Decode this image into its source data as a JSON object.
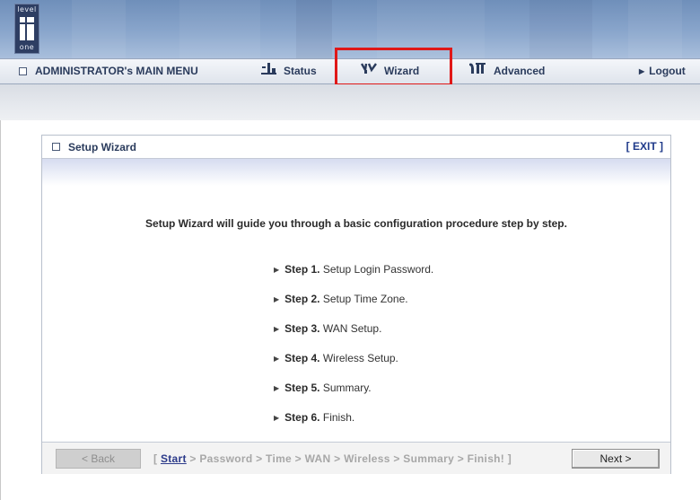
{
  "logo": {
    "line1": "level",
    "line2": "one"
  },
  "menu": {
    "main_label": "ADMINISTRATOR's MAIN MENU",
    "status": "Status",
    "wizard": "Wizard",
    "advanced": "Advanced",
    "logout": "Logout"
  },
  "panel": {
    "title": "Setup Wizard",
    "exit": "[ EXIT ]",
    "intro": "Setup Wizard will guide you through a basic configuration procedure step by step.",
    "steps": [
      {
        "num": "Step 1.",
        "text": "Setup Login Password."
      },
      {
        "num": "Step 2.",
        "text": "Setup Time Zone."
      },
      {
        "num": "Step 3.",
        "text": "WAN Setup."
      },
      {
        "num": "Step 4.",
        "text": "Wireless Setup."
      },
      {
        "num": "Step 5.",
        "text": "Summary."
      },
      {
        "num": "Step 6.",
        "text": "Finish."
      }
    ]
  },
  "footer": {
    "back": "< Back",
    "next": "Next >",
    "crumb_open": "[",
    "crumb_current": "Start",
    "crumb_rest": "> Password > Time > WAN > Wireless > Summary > Finish! ]"
  },
  "colors": {
    "highlight": "#e01818",
    "link": "#1f3a8a",
    "menu_text": "#2a3b5c"
  }
}
